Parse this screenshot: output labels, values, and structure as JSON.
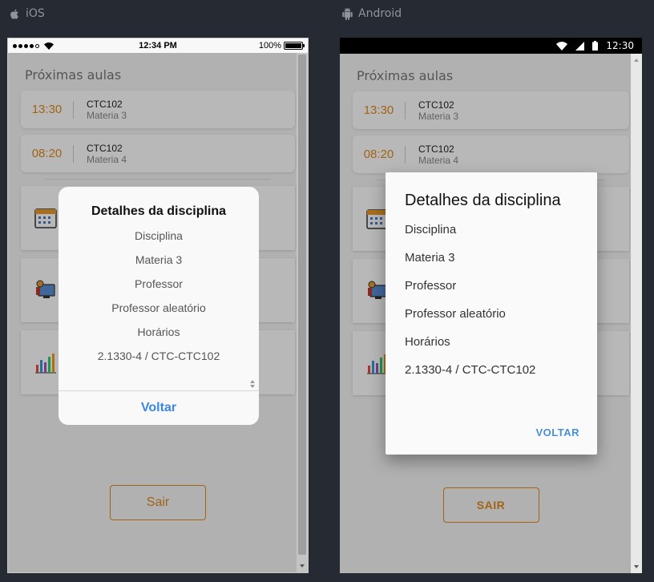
{
  "platforms": {
    "ios_label": "iOS",
    "android_label": "Android"
  },
  "ios_status": {
    "time": "12:34 PM",
    "battery": "100%"
  },
  "android_status": {
    "time": "12:30"
  },
  "screen": {
    "section_title": "Próximas aulas",
    "classes": [
      {
        "time": "13:30",
        "code": "CTC102",
        "subject": "Materia 3"
      },
      {
        "time": "08:20",
        "code": "CTC102",
        "subject": "Materia 4"
      }
    ],
    "menu_icons": [
      "calendar-icon",
      "computer-professor-icon",
      "bar-chart-icon"
    ],
    "exit_ios": "Sair",
    "exit_android": "SAIR"
  },
  "dialog": {
    "title": "Detalhes da disciplina",
    "rows": [
      "Disciplina",
      "Materia 3",
      "Professor",
      "Professor aleatório",
      "Horários",
      "2.1330-4 / CTC-CTC102"
    ],
    "ios_button": "Voltar",
    "android_button": "VOLTAR"
  },
  "colors": {
    "accent": "#e08a1e",
    "link": "#3b87e8",
    "background": "#262b33"
  }
}
